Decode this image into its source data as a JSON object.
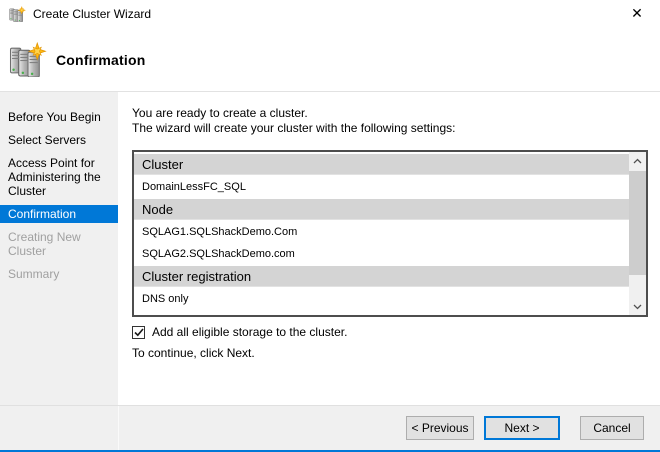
{
  "window": {
    "title": "Create Cluster Wizard",
    "close_glyph": "✕"
  },
  "header": {
    "title": "Confirmation"
  },
  "sidebar": {
    "items": [
      {
        "label": "Before You Begin",
        "state": "normal"
      },
      {
        "label": "Select Servers",
        "state": "normal"
      },
      {
        "label": "Access Point for Administering the Cluster",
        "state": "normal"
      },
      {
        "label": "Confirmation",
        "state": "active"
      },
      {
        "label": "Creating New Cluster",
        "state": "disabled"
      },
      {
        "label": "Summary",
        "state": "disabled"
      }
    ]
  },
  "main": {
    "intro_line1": "You are ready to create a cluster.",
    "intro_line2": "The wizard will create your cluster with the following settings:",
    "settings": [
      {
        "type": "header",
        "text": "Cluster"
      },
      {
        "type": "value",
        "text": "DomainLessFC_SQL"
      },
      {
        "type": "header",
        "text": "Node"
      },
      {
        "type": "value",
        "text": "SQLAG1.SQLShackDemo.Com"
      },
      {
        "type": "value",
        "text": "SQLAG2.SQLShackDemo.com"
      },
      {
        "type": "header",
        "text": "Cluster registration"
      },
      {
        "type": "value",
        "text": "DNS only"
      }
    ],
    "storage_checkbox": {
      "label": "Add all eligible storage to the cluster.",
      "checked": true
    },
    "continue_text": "To continue, click Next."
  },
  "footer": {
    "previous_label": "< Previous",
    "next_label": "Next >",
    "cancel_label": "Cancel"
  },
  "colors": {
    "accent": "#0078d7",
    "active_item_bg": "#0078d7",
    "list_header_bg": "#d4d4d4",
    "footer_bg": "#f0f0f0"
  }
}
